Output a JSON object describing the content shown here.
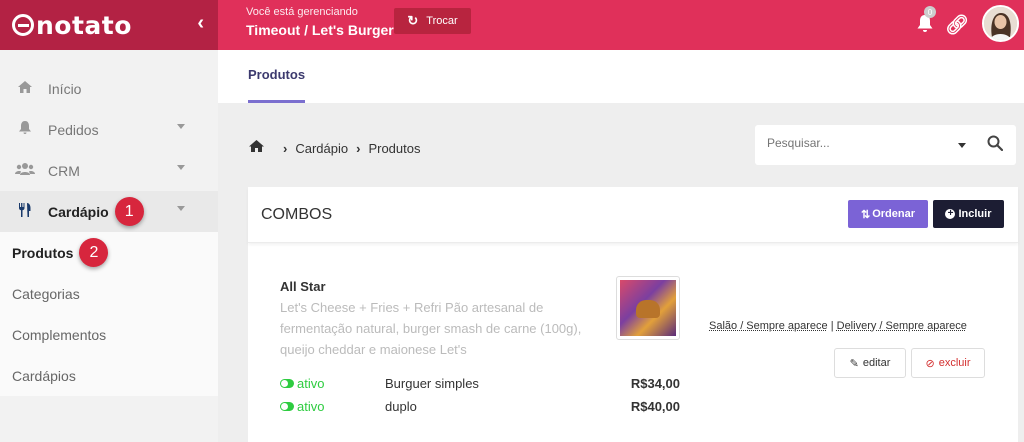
{
  "brand": {
    "logo_text": "notato"
  },
  "topbar": {
    "managing_label": "Você está gerenciando",
    "managing_name": "Timeout / Let's Burger",
    "swap_label": "Trocar",
    "notification_count": "0"
  },
  "sidebar": {
    "items": [
      {
        "label": "Início"
      },
      {
        "label": "Pedidos"
      },
      {
        "label": "CRM"
      },
      {
        "label": "Cardápio",
        "badge": "1"
      }
    ],
    "subitems": [
      {
        "label": "Produtos",
        "badge": "2"
      },
      {
        "label": "Categorias"
      },
      {
        "label": "Complementos"
      },
      {
        "label": "Cardápios"
      }
    ]
  },
  "tabs": {
    "active": "Produtos"
  },
  "breadcrumb": {
    "level1": "Cardápio",
    "level2": "Produtos"
  },
  "search": {
    "placeholder": "Pesquisar..."
  },
  "panel": {
    "title": "COMBOS",
    "order_button": "Ordenar",
    "add_button": "Incluir"
  },
  "product": {
    "name": "All Star",
    "description": "Let's Cheese + Fries + Refri Pão artesanal de fermentação natural, burger smash de carne (100g), queijo cheddar e maionese Let's",
    "channel_salao": "Salão / Sempre aparece",
    "channel_separator": " | ",
    "channel_delivery": "Delivery / Sempre aparece",
    "edit_label": "editar",
    "delete_label": "excluir",
    "variants": [
      {
        "status": "ativo",
        "name": "Burguer simples",
        "price": "R$34,00"
      },
      {
        "status": "ativo",
        "name": "duplo",
        "price": "R$40,00"
      }
    ]
  },
  "colors": {
    "topbar": "#e0305a",
    "logo_bar": "#b32244",
    "accent_purple": "#7b63d6",
    "dark_button": "#1c1d33",
    "active_green": "#2ecc40",
    "badge_red": "#d7263d"
  }
}
